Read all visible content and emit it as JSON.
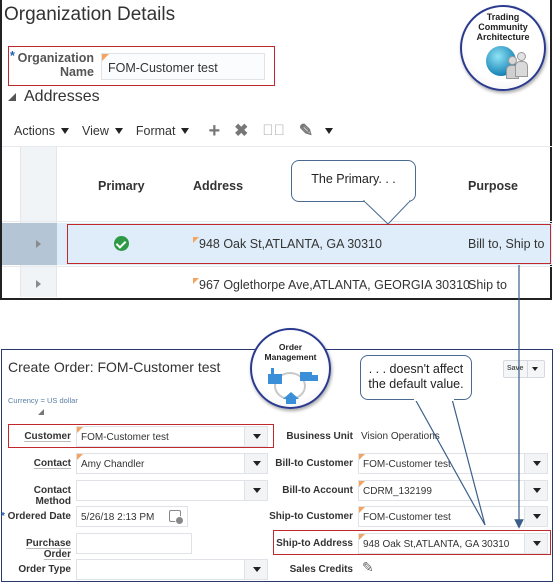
{
  "org_details": {
    "title": "Organization Details",
    "org_name_label_line1": "Organization",
    "org_name_label_line2": "Name",
    "required_marker": "*",
    "org_name_value": "FOM-Customer test",
    "addresses_header": "Addresses",
    "toolbar": {
      "actions": "Actions",
      "view": "View",
      "format": "Format",
      "icons": [
        "add-icon",
        "delete-icon",
        "check-circle-icon",
        "edit-pencil-icon",
        "chevron-down-icon"
      ]
    },
    "table": {
      "columns": [
        "Primary",
        "Address",
        "Purpose"
      ],
      "rows": [
        {
          "primary": true,
          "address": "948 Oak St,ATLANTA, GA 30310",
          "purpose": "Bill to, Ship to",
          "selected": true
        },
        {
          "primary": false,
          "address": "967 Oglethorpe Ave,ATLANTA, GEORGIA 30310",
          "purpose": "Ship to",
          "selected": false
        }
      ]
    }
  },
  "logos": {
    "tca": {
      "line1": "Trading",
      "line2": "Community",
      "line3": "Architecture"
    },
    "om": {
      "line1": "Order",
      "line2": "Management"
    }
  },
  "callouts": {
    "primary": "The Primary. . .",
    "doesnt_affect_line1": ". . . doesn't  affect",
    "doesnt_affect_line2": "the default value."
  },
  "create_order": {
    "title": "Create Order: FOM-Customer test",
    "currency": "Currency = US dollar",
    "save_label": "Save",
    "left_fields": [
      {
        "label": "Customer",
        "value": "FOM-Customer test",
        "type": "dropdown"
      },
      {
        "label": "Contact",
        "value": "Amy Chandler",
        "type": "dropdown"
      },
      {
        "label": "Contact Method",
        "value": "",
        "type": "dropdown"
      },
      {
        "label": "Ordered Date",
        "value": "5/26/18 2:13 PM",
        "type": "date",
        "required": "*"
      },
      {
        "label": "Purchase Order",
        "value": "",
        "type": "text"
      },
      {
        "label": "Order Type",
        "value": "",
        "type": "dropdown"
      }
    ],
    "right_fields": [
      {
        "label": "Business Unit",
        "value": "Vision Operations",
        "type": "readonly"
      },
      {
        "label": "Bill-to Customer",
        "value": "FOM-Customer test",
        "type": "dropdown"
      },
      {
        "label": "Bill-to Account",
        "value": "CDRM_132199",
        "type": "dropdown"
      },
      {
        "label": "Ship-to Customer",
        "value": "FOM-Customer test",
        "type": "dropdown"
      },
      {
        "label": "Ship-to Address",
        "value": "948 Oak St,ATLANTA, GA 30310",
        "type": "dropdown"
      },
      {
        "label": "Sales Credits",
        "value": "",
        "type": "edit-icon"
      }
    ]
  },
  "colors": {
    "highlight_border": "#c0282d",
    "selected_row": "#deedf9",
    "callout_border": "#4a6b8f",
    "panel_border": "#2a3a6f",
    "primary_check": "#2e9a48"
  }
}
